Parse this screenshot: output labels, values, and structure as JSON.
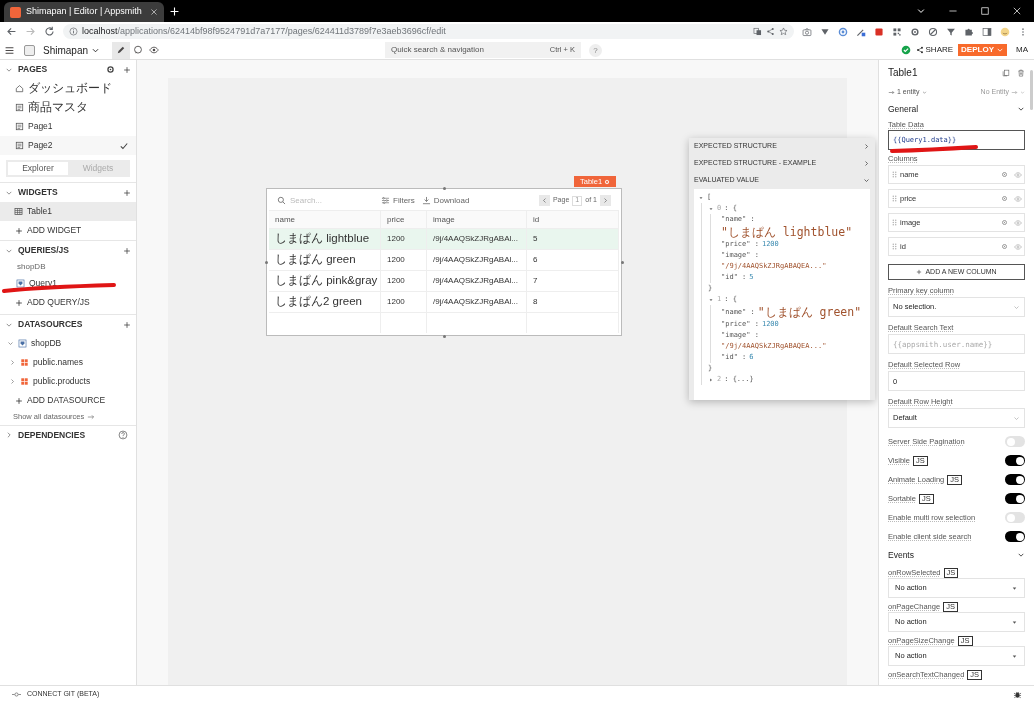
{
  "browser": {
    "tab_title": "Shimapan | Editor | Appsmith",
    "url_host": "localhost",
    "url_path": "/applications/62414bf98f9524791d7a7177/pages/624411d3789f7e3aeb3696cf/edit"
  },
  "header": {
    "app_name": "Shimapan",
    "search": "Quick search & navigation",
    "shortcut": "Ctrl + K",
    "help": "?",
    "share": "SHARE",
    "deploy": "DEPLOY",
    "user": "MA"
  },
  "sidebar": {
    "pages": {
      "title": "PAGES",
      "items": [
        {
          "label": "ダッシュボード",
          "kind": "home",
          "selected": false
        },
        {
          "label": "商品マスタ",
          "kind": "page",
          "selected": false
        },
        {
          "label": "Page1",
          "kind": "page",
          "selected": false
        },
        {
          "label": "Page2",
          "kind": "page",
          "selected": true
        }
      ]
    },
    "tabs": [
      {
        "label": "Explorer",
        "selected": true
      },
      {
        "label": "Widgets",
        "selected": false
      }
    ],
    "widgets": {
      "title": "WIDGETS",
      "items": [
        {
          "label": "Table1",
          "selected": true
        }
      ],
      "add": "ADD WIDGET"
    },
    "queries": {
      "title": "QUERIES/JS",
      "group": "shopDB",
      "items": [
        {
          "label": "Query1",
          "selected": false
        }
      ],
      "add": "ADD QUERY/JS"
    },
    "datasources": {
      "title": "DATASOURCES",
      "items": [
        {
          "label": "shopDB",
          "expanded": true,
          "children": [
            {
              "label": "public.names",
              "expanded": false
            },
            {
              "label": "public.products",
              "expanded": false
            }
          ]
        }
      ],
      "add": "ADD DATASOURCE",
      "show_all": "Show all datasources"
    },
    "dependencies": {
      "title": "DEPENDENCIES",
      "expanded": false
    }
  },
  "table": {
    "widget_name": "Table1",
    "search_placeholder": "Search...",
    "filters": "Filters",
    "download": "Download",
    "page_label": "Page",
    "page": "1",
    "page_total": "of 1",
    "columns": [
      "name",
      "price",
      "image",
      "id"
    ],
    "rows": [
      {
        "cells": [
          "しまぱん lightblue",
          "1200",
          "/9j/4AAQSkZJRgABAl...",
          "5"
        ],
        "selected": true
      },
      {
        "cells": [
          "しまぱん green",
          "1200",
          "/9j/4AAQSkZJRgABAl...",
          "6"
        ],
        "selected": false
      },
      {
        "cells": [
          "しまぱん pink&gray",
          "1200",
          "/9j/4AAQSkZJRgABAl...",
          "7"
        ],
        "selected": false
      },
      {
        "cells": [
          "しまぱん2 green",
          "1200",
          "/9j/4AAQSkZJRgABAl...",
          "8"
        ],
        "selected": false
      }
    ]
  },
  "evaluation_popup": {
    "sections": [
      {
        "label": "EXPECTED STRUCTURE",
        "expanded": false
      },
      {
        "label": "EXPECTED STRUCTURE - EXAMPLE",
        "expanded": false
      },
      {
        "label": "EVALUATED VALUE",
        "expanded": true
      }
    ],
    "value": {
      "open": "[",
      "items": [
        {
          "index": "0",
          "expanded": true,
          "open": ": {",
          "close": "}",
          "fields": [
            {
              "key": "\"name\" :",
              "value": "\"しまぱん lightblue\"",
              "kind": "string",
              "wrap": true
            },
            {
              "key": "\"price\" :",
              "value": "1200",
              "kind": "number",
              "wrap": false
            },
            {
              "key": "\"image\" :",
              "value": "\"/9j/4AAQSkZJRgABAQEA...\"",
              "kind": "string",
              "wrap": true
            },
            {
              "key": "\"id\" :",
              "value": "5",
              "kind": "number",
              "wrap": false
            }
          ]
        },
        {
          "index": "1",
          "expanded": true,
          "open": ": {",
          "close": "}",
          "fields": [
            {
              "key": "\"name\" :",
              "value": "\"しまぱん green\"",
              "kind": "string",
              "wrap": false
            },
            {
              "key": "\"price\" :",
              "value": "1200",
              "kind": "number",
              "wrap": false
            },
            {
              "key": "\"image\" :",
              "value": "\"/9j/4AAQSkZJRgABAQEA...\"",
              "kind": "string",
              "wrap": true
            },
            {
              "key": "\"id\" :",
              "value": "6",
              "kind": "number",
              "wrap": false
            }
          ]
        },
        {
          "index": "2",
          "expanded": false,
          "summary": ": {...}"
        }
      ]
    }
  },
  "properties": {
    "title": "Table1",
    "entity": "1 entity",
    "no_entity": "No Entity",
    "sections": [
      {
        "title": "General",
        "expanded": true,
        "fields": [
          {
            "kind": "code",
            "label": "Table Data",
            "value": "{{Query1.data}}"
          },
          {
            "kind": "columns",
            "label": "Columns",
            "columns": [
              "name",
              "price",
              "image",
              "id"
            ],
            "add": "ADD A NEW COLUMN"
          },
          {
            "kind": "select",
            "label": "Primary key column",
            "value": "No selection."
          },
          {
            "kind": "input",
            "label": "Default Search Text",
            "placeholder": "{{appsmith.user.name}}"
          },
          {
            "kind": "input",
            "label": "Default Selected Row",
            "value": "0"
          },
          {
            "kind": "select",
            "label": "Default Row Height",
            "value": "Default"
          },
          {
            "kind": "toggle",
            "label": "Server Side Pagination",
            "on": false
          },
          {
            "kind": "toggle",
            "label": "Visible",
            "badge": "JS",
            "on": true
          },
          {
            "kind": "toggle",
            "label": "Animate Loading",
            "badge": "JS",
            "on": true
          },
          {
            "kind": "toggle",
            "label": "Sortable",
            "badge": "JS",
            "on": true
          },
          {
            "kind": "toggle",
            "label": "Enable multi row selection",
            "on": false
          },
          {
            "kind": "toggle",
            "label": "Enable client side search",
            "on": true
          }
        ]
      },
      {
        "title": "Events",
        "expanded": true,
        "fields": [
          {
            "kind": "action",
            "label": "onRowSelected",
            "badge": "JS",
            "value": "No action"
          },
          {
            "kind": "action",
            "label": "onPageChange",
            "badge": "JS",
            "value": "No action"
          },
          {
            "kind": "action",
            "label": "onPageSizeChange",
            "badge": "JS",
            "value": "No action"
          },
          {
            "kind": "label",
            "label": "onSearchTextChanged",
            "badge": "JS"
          }
        ]
      }
    ]
  },
  "bottom_bar": {
    "git": "CONNECT GIT (BETA)"
  }
}
